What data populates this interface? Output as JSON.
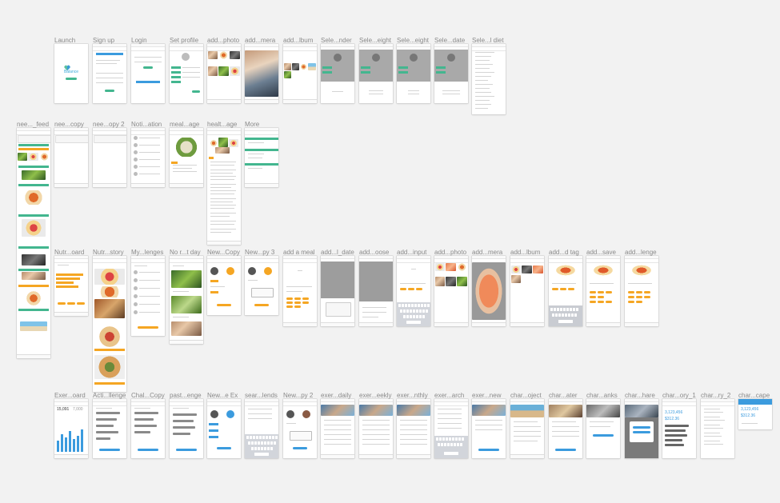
{
  "boards": {
    "r1": [
      "Launch",
      "Sign up",
      "Login",
      "Set profile",
      "add...photo",
      "add...mera",
      "add...lbum",
      "Sele...nder",
      "Sele...eight",
      "Sele...eight",
      "Sele...date",
      "Sele...l diet"
    ],
    "r2": [
      "nee..._feed",
      "nee...copy",
      "nee...opy 2",
      "Noti...ation",
      "meal...age",
      "healt...age",
      "More"
    ],
    "r3": [
      "Nutr...oard",
      "Nutr...story",
      "My...lenges",
      "No r...t day",
      "New...Copy",
      "New...py 3",
      "add a meal",
      "add...l_date",
      "add...oose",
      "add...input",
      "add...photo",
      "add...mera",
      "add...lbum",
      "add...d tag",
      "add...save",
      "add...lenge"
    ],
    "r4": [
      "Exer...oard",
      "Acti...llenge",
      "Chal...Copy",
      "past...enge",
      "New...e Ex",
      "sear...lends",
      "New...py 2",
      "exer...daily",
      "exer...eekly",
      "exer...nthly",
      "exer...arch",
      "exer...new",
      "char...oject",
      "char...ater",
      "char...anks",
      "char...hare",
      "char...ory_1",
      "char...ry_2",
      "char...cape"
    ]
  },
  "launch_logo": "Balance",
  "stat_big": "15,091",
  "stat_small": "7,000",
  "stat_blue_1": "3,123,456",
  "stat_blue_2": "$312.36",
  "stat_blue_3": "3,123,456",
  "stat_blue_4": "$312.36",
  "colors": {
    "teal": "#43b68f",
    "orange": "#f5a623",
    "blue": "#3b9bde",
    "background": "#f2f2f2"
  }
}
